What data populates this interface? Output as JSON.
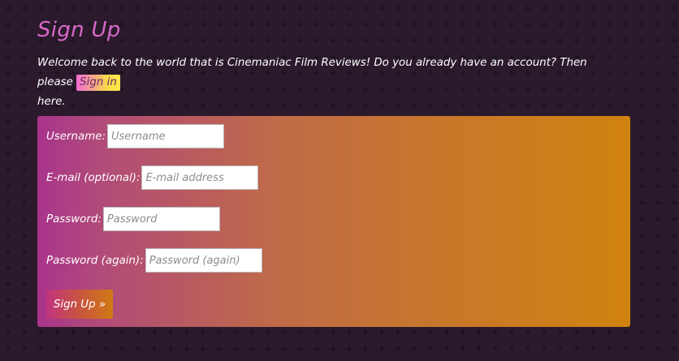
{
  "page": {
    "title": "Sign Up",
    "intro_text": "Welcome back to the world that is Cinemaniac Film Reviews! Do you already have an account? Then please",
    "signin_link": "Sign in",
    "intro_suffix": "here."
  },
  "form": {
    "username": {
      "label": "Username:",
      "placeholder": "Username",
      "value": ""
    },
    "email": {
      "label": "E-mail (optional):",
      "placeholder": "E-mail address",
      "value": ""
    },
    "password": {
      "label": "Password:",
      "placeholder": "Password",
      "value": ""
    },
    "password_again": {
      "label": "Password (again):",
      "placeholder": "Password (again)",
      "value": ""
    },
    "submit_label": "Sign Up »"
  },
  "colors": {
    "background": "#2a1a2c",
    "title": "#d768c8",
    "panel_start": "#a8348c",
    "panel_end": "#d0820f",
    "link_gradient_start": "#f26ad4",
    "link_gradient_end": "#ffe94a"
  }
}
